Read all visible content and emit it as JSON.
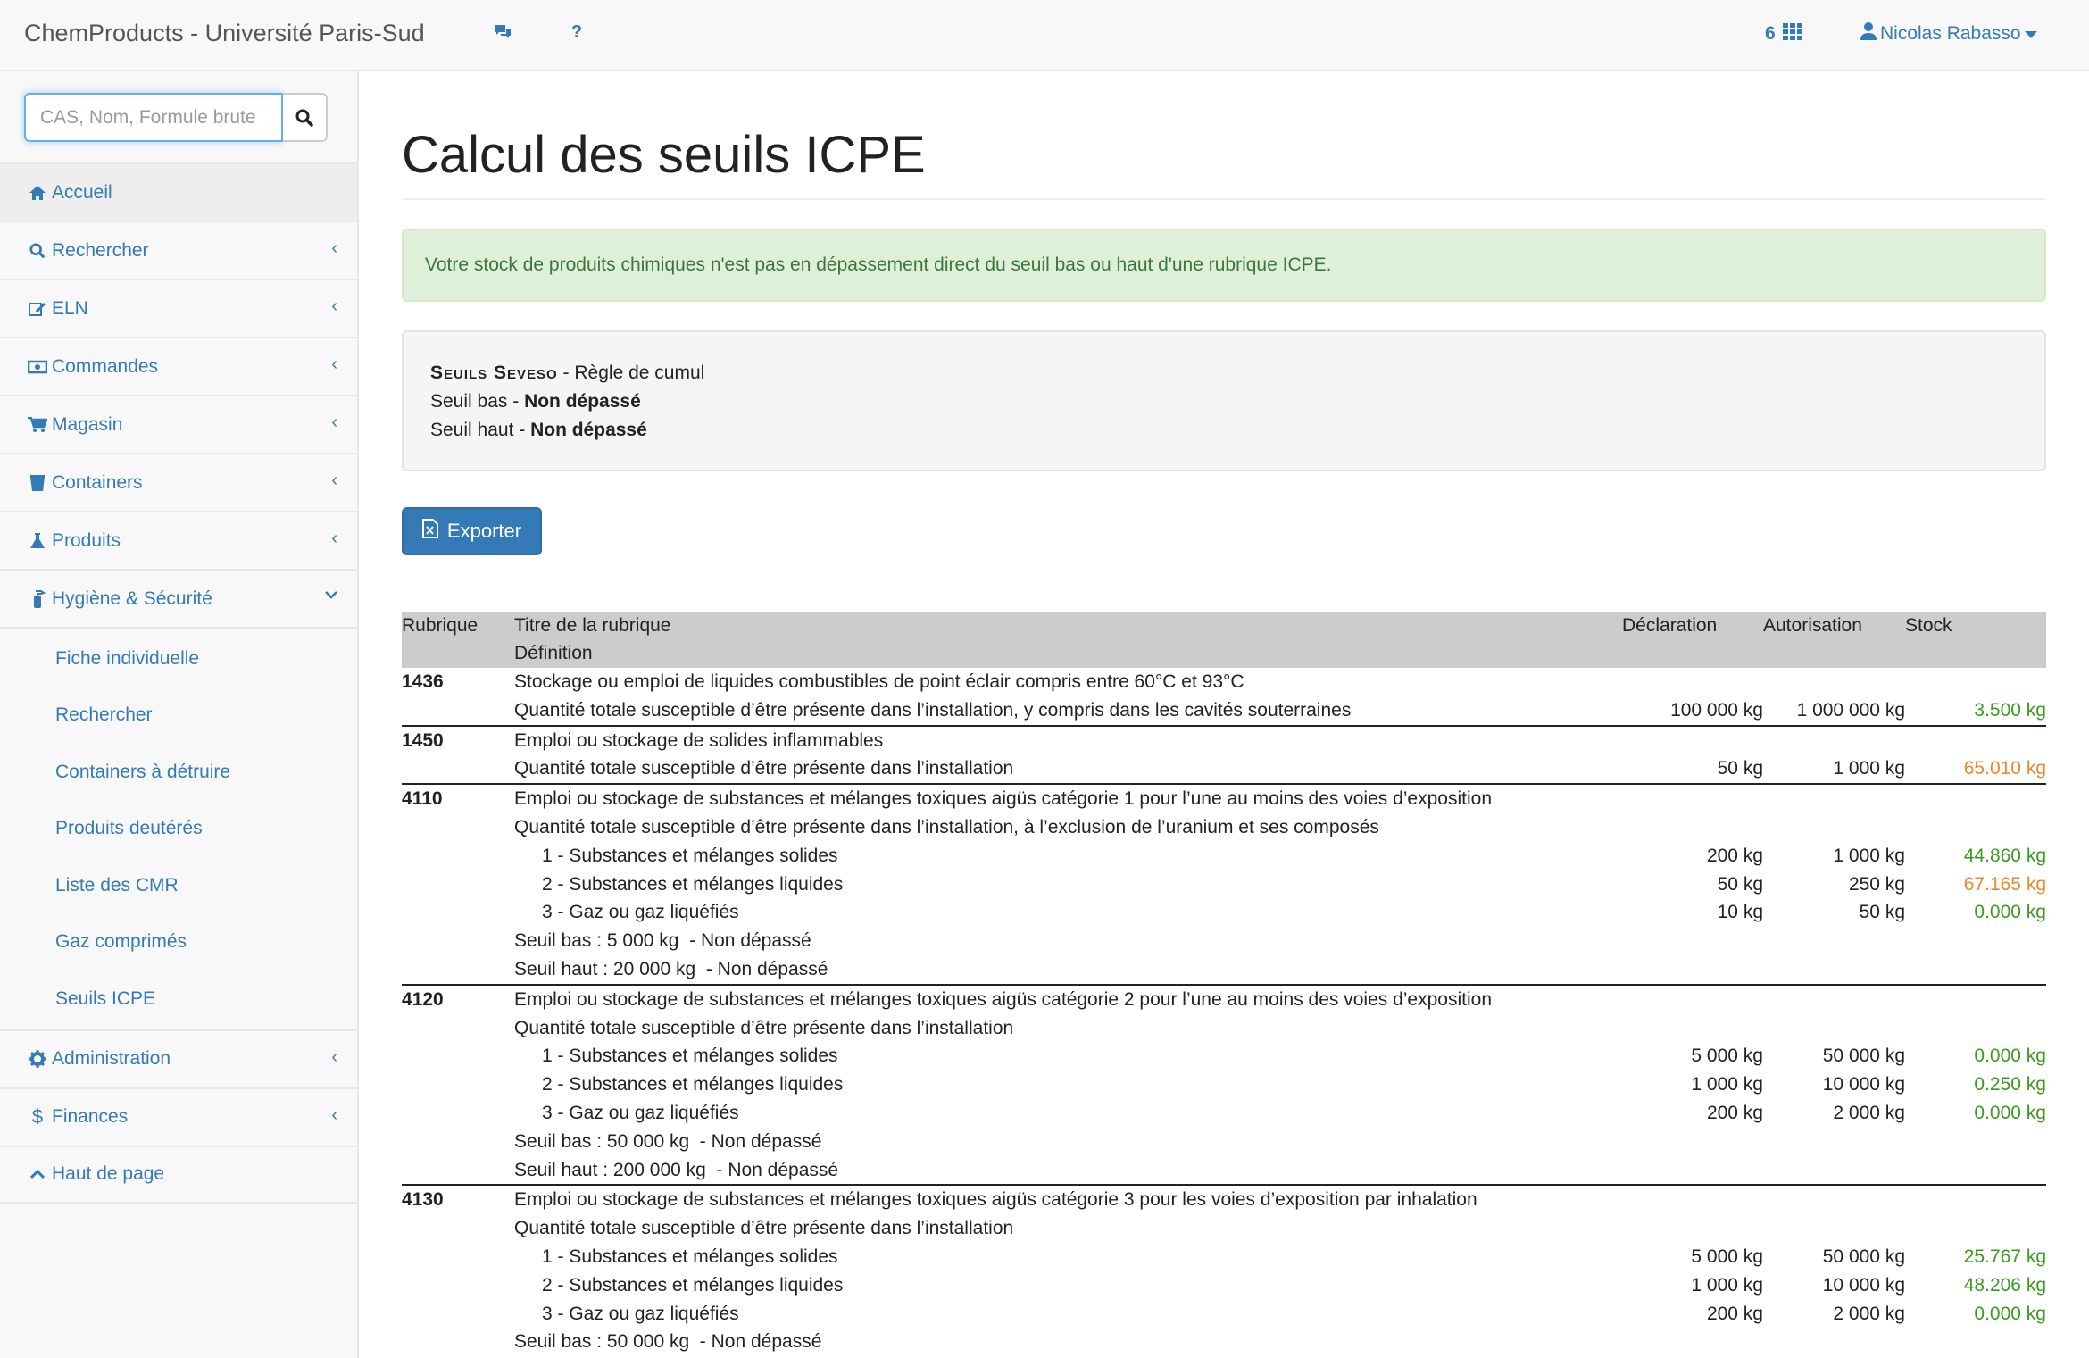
{
  "navbar": {
    "brand": "ChemProducts - Université Paris-Sud",
    "chat_icon": "comments-icon",
    "help_label": "?",
    "count": "6",
    "user": "Nicolas Rabasso"
  },
  "search": {
    "placeholder": "CAS, Nom, Formule brute"
  },
  "menu": [
    {
      "label": "Accueil",
      "icon": "home-icon"
    },
    {
      "label": "Rechercher",
      "icon": "search-icon"
    },
    {
      "label": "ELN",
      "icon": "edit-icon"
    },
    {
      "label": "Commandes",
      "icon": "money-icon"
    },
    {
      "label": "Magasin",
      "icon": "cart-icon"
    },
    {
      "label": "Containers",
      "icon": "bucket-icon"
    },
    {
      "label": "Produits",
      "icon": "flask-icon"
    },
    {
      "label": "Hygiène & Sécurité",
      "icon": "extinguisher-icon"
    }
  ],
  "submenu": [
    "Fiche individuelle",
    "Rechercher",
    "Containers à détruire",
    "Produits deutérés",
    "Liste des CMR",
    "Gaz comprimés",
    "Seuils ICPE"
  ],
  "menu_bottom": [
    {
      "label": "Administration",
      "icon": "gear-icon"
    },
    {
      "label": "Finances",
      "icon": "dollar-icon"
    },
    {
      "label": "Haut de page",
      "icon": "chevron-up-icon"
    }
  ],
  "page": {
    "title": "Calcul des seuils ICPE",
    "alert": "Votre stock de produits chimiques n'est pas en dépassement direct du seuil bas ou haut d'une rubrique ICPE.",
    "seveso_title": "Seuils Seveso",
    "seveso_rule": " - Règle de cumul",
    "seuil_bas_label": "Seuil bas - ",
    "seuil_bas_value": "Non dépassé",
    "seuil_haut_label": "Seuil haut - ",
    "seuil_haut_value": "Non dépassé",
    "export_label": "Exporter"
  },
  "table": {
    "headers": {
      "rubrique": "Rubrique",
      "titre": "Titre de la rubrique",
      "definition": "Définition",
      "declaration": "Déclaration",
      "autorisation": "Autorisation",
      "stock": "Stock"
    },
    "s1436": {
      "code": "1436",
      "title": "Stockage ou emploi de liquides combustibles de point éclair compris entre 60°C et 93°C",
      "def": "Quantité totale susceptible d’être présente dans l’installation, y compris dans les cavités souterraines",
      "decl": "100 000 kg",
      "auth": "1 000 000 kg",
      "stock": "3.500 kg"
    },
    "s1450": {
      "code": "1450",
      "title": "Emploi ou stockage de solides inflammables",
      "def": "Quantité totale susceptible d’être présente dans l’installation",
      "decl": "50 kg",
      "auth": "1 000 kg",
      "stock": "65.010 kg"
    },
    "s4110": {
      "code": "4110",
      "title": "Emploi ou stockage de substances et mélanges toxiques aigüs catégorie 1 pour l’une au moins des voies d’exposition",
      "def": "Quantité totale susceptible d’être présente dans l’installation, à l’exclusion de l’uranium et ses composés",
      "r1": {
        "label": "1 - Substances et mélanges solides",
        "decl": "200 kg",
        "auth": "1 000 kg",
        "stock": "44.860 kg"
      },
      "r2": {
        "label": "2 - Substances et mélanges liquides",
        "decl": "50 kg",
        "auth": "250 kg",
        "stock": "67.165 kg"
      },
      "r3": {
        "label": "3 - Gaz ou gaz liquéfiés",
        "decl": "10 kg",
        "auth": "50 kg",
        "stock": "0.000 kg"
      },
      "bas": "Seuil bas : 5 000 kg  - Non dépassé",
      "haut": "Seuil haut : 20 000 kg  - Non dépassé"
    },
    "s4120": {
      "code": "4120",
      "title": "Emploi ou stockage de substances et mélanges toxiques aigüs catégorie 2 pour l’une au moins des voies d’exposition",
      "def": "Quantité totale susceptible d’être présente dans l’installation",
      "r1": {
        "label": "1 - Substances et mélanges solides",
        "decl": "5 000 kg",
        "auth": "50 000 kg",
        "stock": "0.000 kg"
      },
      "r2": {
        "label": "2 - Substances et mélanges liquides",
        "decl": "1 000 kg",
        "auth": "10 000 kg",
        "stock": "0.250 kg"
      },
      "r3": {
        "label": "3 - Gaz ou gaz liquéfiés",
        "decl": "200 kg",
        "auth": "2 000 kg",
        "stock": "0.000 kg"
      },
      "bas": "Seuil bas : 50 000 kg  - Non dépassé",
      "haut": "Seuil haut : 200 000 kg  - Non dépassé"
    },
    "s4130": {
      "code": "4130",
      "title": "Emploi ou stockage de substances et mélanges toxiques aigüs catégorie 3 pour les voies d’exposition par inhalation",
      "def": "Quantité totale susceptible d’être présente dans l’installation",
      "r1": {
        "label": "1 - Substances et mélanges solides",
        "decl": "5 000 kg",
        "auth": "50 000 kg",
        "stock": "25.767 kg"
      },
      "r2": {
        "label": "2 - Substances et mélanges liquides",
        "decl": "1 000 kg",
        "auth": "10 000 kg",
        "stock": "48.206 kg"
      },
      "r3": {
        "label": "3 - Gaz ou gaz liquéfiés",
        "decl": "200 kg",
        "auth": "2 000 kg",
        "stock": "0.000 kg"
      },
      "bas": "Seuil bas : 50 000 kg  - Non dépassé"
    }
  },
  "colors": {
    "link": "#337ab7",
    "ok": "#3a9a1e",
    "warn": "#e8892b",
    "alert_bg": "#dff0d8"
  }
}
